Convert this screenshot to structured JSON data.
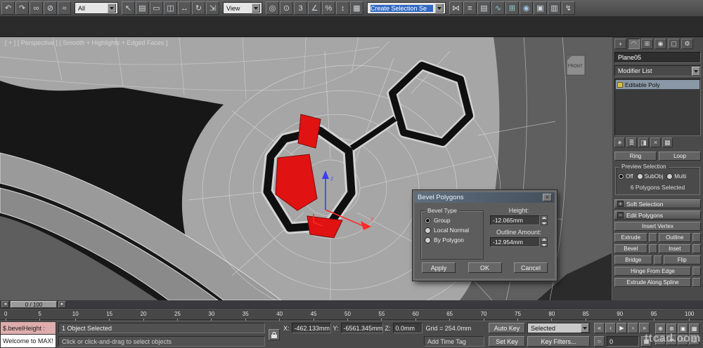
{
  "toolbar": {
    "icons1": [
      {
        "name": "undo-icon",
        "glyph": "↶"
      },
      {
        "name": "redo-icon",
        "glyph": "↷"
      },
      {
        "name": "select-and-link-icon",
        "glyph": "∞"
      },
      {
        "name": "unlink-selection-icon",
        "glyph": "⊘"
      },
      {
        "name": "bind-to-spacewarp-icon",
        "glyph": "≈"
      }
    ],
    "selection_filter": "All",
    "icons2": [
      {
        "name": "select-object-icon",
        "glyph": "↖"
      },
      {
        "name": "select-by-name-icon",
        "glyph": "▤"
      },
      {
        "name": "rectangular-selection-region-icon",
        "glyph": "▭"
      },
      {
        "name": "window-crossing-icon",
        "glyph": "◫"
      },
      {
        "name": "select-and-move-icon",
        "glyph": "↔"
      },
      {
        "name": "select-and-rotate-icon",
        "glyph": "↻"
      },
      {
        "name": "select-and-scale-icon",
        "glyph": "⇲"
      }
    ],
    "ref_coord": "View",
    "icons3": [
      {
        "name": "use-pivot-point-icon",
        "glyph": "◎"
      },
      {
        "name": "select-and-manipulate-icon",
        "glyph": "⊙"
      },
      {
        "name": "snaps-toggle-icon",
        "glyph": "3"
      },
      {
        "name": "angle-snap-icon",
        "glyph": "∠"
      },
      {
        "name": "percent-snap-icon",
        "glyph": "%"
      },
      {
        "name": "spinner-snap-icon",
        "glyph": "↕"
      },
      {
        "name": "edit-named-selection-sets-icon",
        "glyph": "▦"
      }
    ],
    "named_selection": "Create Selection Se",
    "icons4": [
      {
        "name": "mirror-icon",
        "glyph": "⋈"
      },
      {
        "name": "align-icon",
        "glyph": "≡"
      },
      {
        "name": "layer-manager-icon",
        "glyph": "▤"
      },
      {
        "name": "graph-editors-icon",
        "glyph": "∿"
      },
      {
        "name": "schematic-view-icon",
        "glyph": "⊞"
      },
      {
        "name": "material-editor-icon",
        "glyph": "◉"
      },
      {
        "name": "render-setup-icon",
        "glyph": "▣"
      },
      {
        "name": "rendered-frame-window-icon",
        "glyph": "▥"
      },
      {
        "name": "quick-render-icon",
        "glyph": "↯"
      }
    ]
  },
  "viewport": {
    "label": "[ + ] [ Perspective ] [ Smooth + Highlights + Edged Faces ]",
    "front_tag": "FRONT",
    "axis_x": "x",
    "axis_z": "z"
  },
  "dialog": {
    "title": "Bevel Polygons",
    "close_glyph": "×",
    "bevel_type_label": "Bevel Type",
    "radios": [
      "Group",
      "Local Normal",
      "By Polygon"
    ],
    "height_label": "Height:",
    "height_value": "-12.065mm",
    "outline_label": "Outline Amount:",
    "outline_value": "-12.954mm",
    "apply_label": "Apply",
    "ok_label": "OK",
    "cancel_label": "Cancel"
  },
  "panel": {
    "tabs": [
      {
        "name": "create-tab",
        "glyph": "+"
      },
      {
        "name": "modify-tab",
        "glyph": "◠"
      },
      {
        "name": "hierarchy-tab",
        "glyph": "⊞"
      },
      {
        "name": "motion-tab",
        "glyph": "◉"
      },
      {
        "name": "display-tab",
        "glyph": "▢"
      },
      {
        "name": "utilities-tab",
        "glyph": "⚙"
      }
    ],
    "object_name": "Plane05",
    "modifier_list_label": "Modifier List",
    "stack_item": "Editable Poly",
    "stack_tools": [
      {
        "name": "pin-stack-icon",
        "glyph": "∗"
      },
      {
        "name": "show-end-result-icon",
        "glyph": "≣"
      },
      {
        "name": "make-unique-icon",
        "glyph": "◨"
      },
      {
        "name": "remove-modifier-icon",
        "glyph": "×"
      },
      {
        "name": "configure-modifier-sets-icon",
        "glyph": "▦"
      }
    ],
    "ring_label": "Ring",
    "loop_label": "Loop",
    "preview_title": "Preview Selection",
    "preview_options": [
      "Off",
      "SubObj",
      "Multi"
    ],
    "selection_status": "6 Polygons Selected",
    "plus_glyph": "+",
    "minus_glyph": "−",
    "soft_selection_title": "Soft Selection",
    "edit_polygons_title": "Edit Polygons",
    "insert_vertex": "Insert Vertex",
    "btn_rows": [
      [
        "Extrude",
        "Outline"
      ],
      [
        "Bevel",
        "Inset"
      ],
      [
        "Bridge",
        "Flip"
      ]
    ],
    "hinge": "Hinge From Edge",
    "extrude_along_spline": "Extrude Along Spline"
  },
  "timeline": {
    "slider_label": "0 / 100",
    "prev_glyph": "◂",
    "next_glyph": "▸",
    "ticks": [
      "0",
      "5",
      "10",
      "15",
      "20",
      "25",
      "30",
      "35",
      "40",
      "45",
      "50",
      "55",
      "60",
      "65",
      "70",
      "75",
      "80",
      "85",
      "90",
      "95",
      "100"
    ]
  },
  "statusbar": {
    "script_line": "$.bevelHeight :",
    "listener_line": "Welcome to MAX!",
    "status_line": "1 Object Selected",
    "prompt_line": "Click or click-and-drag to select objects",
    "x_label": "X:",
    "x_value": "-462.133mm",
    "y_label": "Y:",
    "y_value": "-6561.345mm",
    "z_label": "Z:",
    "z_value": "0.0mm",
    "grid_label": "Grid = 254.0mm",
    "time_tag": "Add Time Tag",
    "auto_key": "Auto Key",
    "set_key": "Set Key",
    "selected_dropdown": "Selected",
    "key_filters": "Key Filters...",
    "frame_value": "0",
    "key_mode_glyph": "○",
    "time_config_glyph": "▦",
    "playback": [
      {
        "name": "go-to-start-button",
        "glyph": "«"
      },
      {
        "name": "previous-frame-button",
        "glyph": "‹"
      },
      {
        "name": "play-button",
        "glyph": "▶"
      },
      {
        "name": "next-frame-button",
        "glyph": "›"
      },
      {
        "name": "go-to-end-button",
        "glyph": "»"
      }
    ],
    "nav": [
      {
        "name": "zoom-icon",
        "glyph": "⊕"
      },
      {
        "name": "zoom-all-icon",
        "glyph": "⊛"
      },
      {
        "name": "zoom-extents-icon",
        "glyph": "▣"
      },
      {
        "name": "zoom-extents-all-icon",
        "glyph": "▦"
      },
      {
        "name": "zoom-region-icon",
        "glyph": "▭"
      },
      {
        "name": "pan-icon",
        "glyph": "⇹"
      },
      {
        "name": "orbit-icon",
        "glyph": "↻"
      },
      {
        "name": "maximize-viewport-toggle-icon",
        "glyph": "◱"
      }
    ],
    "watermark": "ttcad.com"
  }
}
